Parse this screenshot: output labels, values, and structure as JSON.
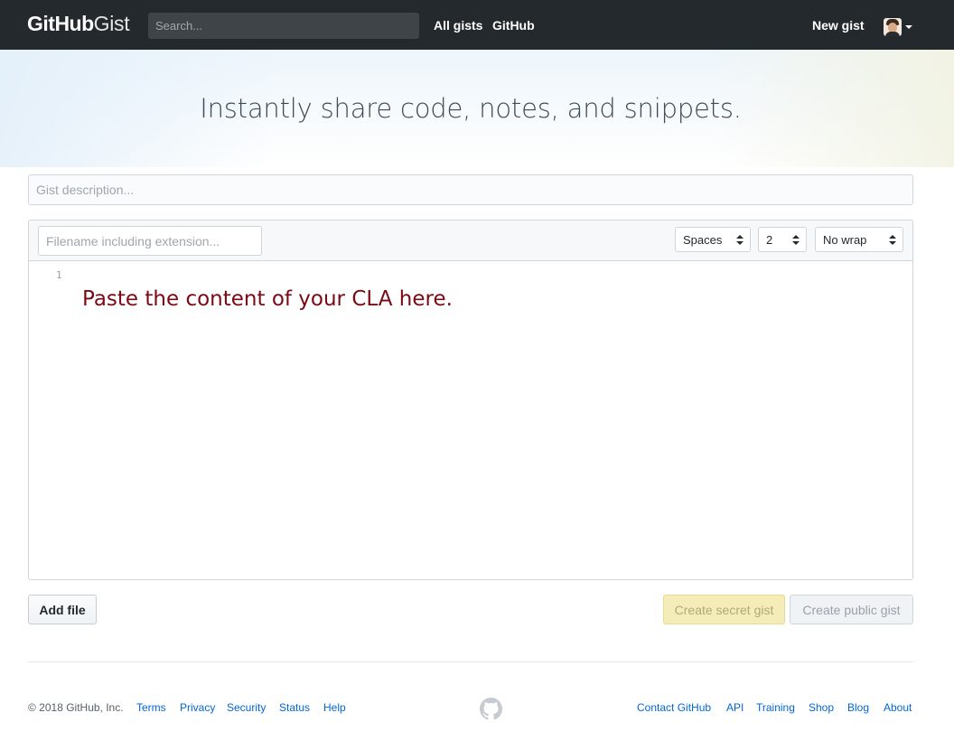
{
  "header": {
    "logo_bold": "GitHub",
    "logo_light": "Gist",
    "search_placeholder": "Search...",
    "nav": [
      "All gists",
      "GitHub"
    ],
    "new_gist": "New gist",
    "avatar_icon": "user-avatar"
  },
  "hero": {
    "title": "Instantly share code, notes, and snippets."
  },
  "form": {
    "description_placeholder": "Gist description...",
    "filename_placeholder": "Filename including extension...",
    "indent_mode": "Spaces",
    "indent_size": "2",
    "wrap_mode": "No wrap",
    "line_number": "1",
    "content": "Paste the content of your CLA here."
  },
  "buttons": {
    "add_file": "Add file",
    "create_secret": "Create secret gist",
    "create_public": "Create public gist"
  },
  "footer": {
    "copyright": "© 2018 GitHub, Inc.",
    "left_links": [
      "Terms",
      "Privacy",
      "Security",
      "Status",
      "Help"
    ],
    "right_links": [
      "Contact GitHub",
      "API",
      "Training",
      "Shop",
      "Blog",
      "About"
    ],
    "center_icon": "octocat-icon"
  },
  "colors": {
    "header_bg": "#24292e",
    "link": "#0366d6",
    "secret_btn_bg": "#f4ecb9",
    "editor_text": "#7a0a15"
  }
}
